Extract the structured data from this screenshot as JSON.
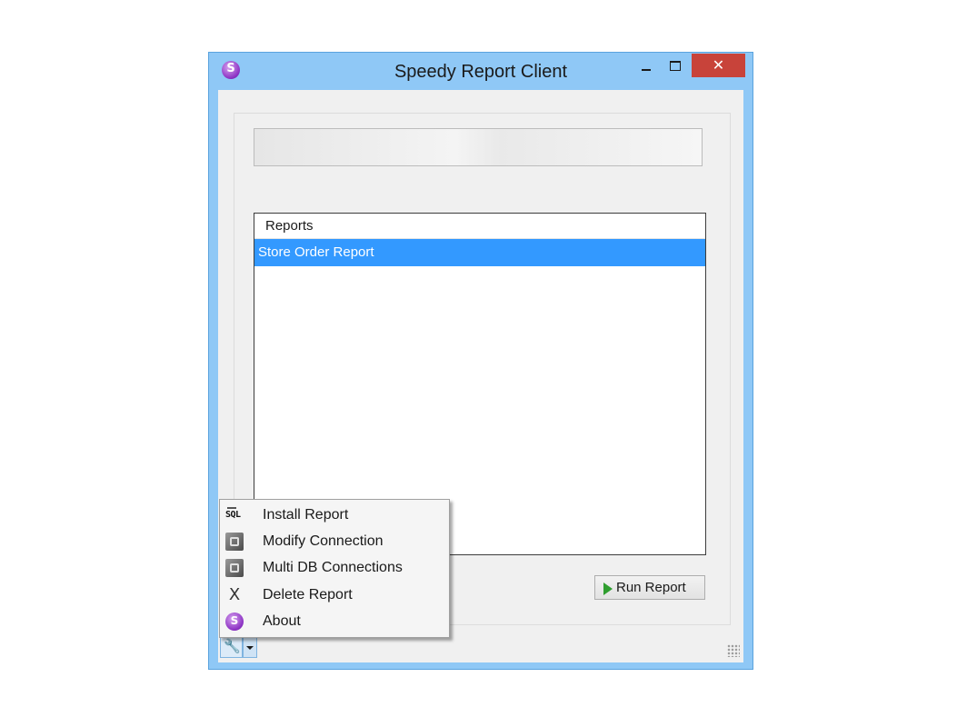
{
  "window": {
    "title": "Speedy Report Client",
    "controls": {
      "minimize": "minimize",
      "maximize": "maximize",
      "close": "✕"
    }
  },
  "reports_list": {
    "column_header": "Reports",
    "items": [
      {
        "label": "Store Order Report",
        "selected": true
      }
    ]
  },
  "run_button": {
    "label": "Run Report",
    "icon": "play-icon"
  },
  "toolbar": {
    "tools_icon": "wrench-icon",
    "dropdown_icon": "chevron-down-icon"
  },
  "context_menu": {
    "items": [
      {
        "label": "Install Report",
        "icon": "sql-icon"
      },
      {
        "label": "Modify Connection",
        "icon": "modify-connection-icon"
      },
      {
        "label": "Multi DB Connections",
        "icon": "multi-db-icon"
      },
      {
        "label": "Delete Report",
        "icon": "x-icon"
      },
      {
        "label": "About",
        "icon": "app-logo-icon"
      }
    ]
  },
  "colors": {
    "window_frame": "#8fc8f6",
    "close_button": "#c8433a",
    "selection": "#3399ff",
    "run_icon": "#2f9e2f"
  }
}
